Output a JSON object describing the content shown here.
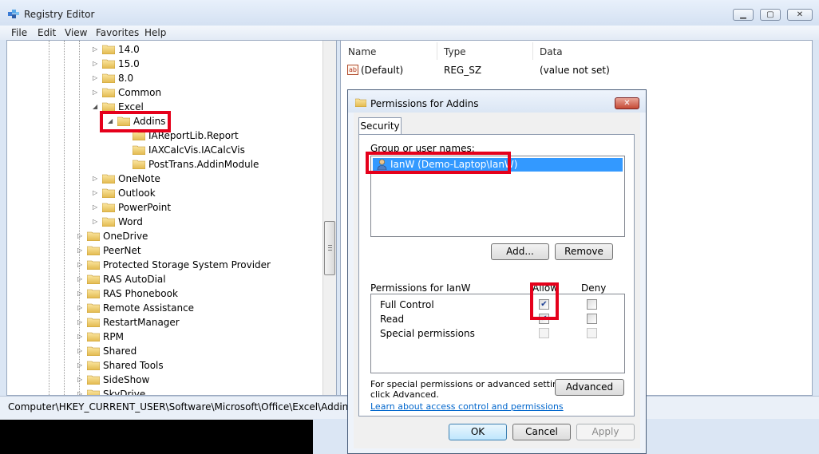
{
  "window": {
    "title": "Registry Editor",
    "controls": {
      "minimize": "▁",
      "maximize": "▢",
      "close": "✕"
    }
  },
  "menu": [
    "File",
    "Edit",
    "View",
    "Favorites",
    "Help"
  ],
  "tree": {
    "items": [
      {
        "label": "14.0",
        "level": 5,
        "toggle": "▷"
      },
      {
        "label": "15.0",
        "level": 5,
        "toggle": "▷"
      },
      {
        "label": "8.0",
        "level": 5,
        "toggle": "▷"
      },
      {
        "label": "Common",
        "level": 5,
        "toggle": "▷"
      },
      {
        "label": "Excel",
        "level": 5,
        "toggle": "◢"
      },
      {
        "label": "Addins",
        "level": 6,
        "toggle": "◢"
      },
      {
        "label": "IAReportLib.Report",
        "level": 7,
        "toggle": ""
      },
      {
        "label": "IAXCalcVis.IACalcVis",
        "level": 7,
        "toggle": ""
      },
      {
        "label": "PostTrans.AddinModule",
        "level": 7,
        "toggle": ""
      },
      {
        "label": "OneNote",
        "level": 5,
        "toggle": "▷"
      },
      {
        "label": "Outlook",
        "level": 5,
        "toggle": "▷"
      },
      {
        "label": "PowerPoint",
        "level": 5,
        "toggle": "▷"
      },
      {
        "label": "Word",
        "level": 5,
        "toggle": "▷"
      },
      {
        "label": "OneDrive",
        "level": 4,
        "toggle": "▷"
      },
      {
        "label": "PeerNet",
        "level": 4,
        "toggle": "▷"
      },
      {
        "label": "Protected Storage System Provider",
        "level": 4,
        "toggle": "▷"
      },
      {
        "label": "RAS AutoDial",
        "level": 4,
        "toggle": "▷"
      },
      {
        "label": "RAS Phonebook",
        "level": 4,
        "toggle": "▷"
      },
      {
        "label": "Remote Assistance",
        "level": 4,
        "toggle": "▷"
      },
      {
        "label": "RestartManager",
        "level": 4,
        "toggle": "▷"
      },
      {
        "label": "RPM",
        "level": 4,
        "toggle": "▷"
      },
      {
        "label": "Shared",
        "level": 4,
        "toggle": "▷"
      },
      {
        "label": "Shared Tools",
        "level": 4,
        "toggle": "▷"
      },
      {
        "label": "SideShow",
        "level": 4,
        "toggle": "▷"
      },
      {
        "label": "SkyDrive",
        "level": 4,
        "toggle": "▷"
      }
    ]
  },
  "values_list": {
    "columns": [
      "Name",
      "Type",
      "Data"
    ],
    "rows": [
      {
        "icon": "ab",
        "name": "(Default)",
        "type": "REG_SZ",
        "data": "(value not set)"
      }
    ]
  },
  "status_path": "Computer\\HKEY_CURRENT_USER\\Software\\Microsoft\\Office\\Excel\\Addins",
  "dialog": {
    "title": "Permissions for Addins",
    "close": "✕",
    "tab": "Security",
    "group_label": "Group or user names:",
    "users": [
      "IanW (Demo-Laptop\\IanW)"
    ],
    "add_button": "Add...",
    "remove_button": "Remove",
    "permissions_for": "Permissions for IanW",
    "allow_header": "Allow",
    "deny_header": "Deny",
    "permissions": [
      {
        "name": "Full Control",
        "allow": "✔",
        "deny": ""
      },
      {
        "name": "Read",
        "allow": "✔",
        "deny": ""
      },
      {
        "name": "Special permissions",
        "allow": "",
        "deny": ""
      }
    ],
    "special_note_line1": "For special permissions or advanced settings,",
    "special_note_line2": "click Advanced.",
    "advanced_button": "Advanced",
    "learn_link": "Learn about access control and permissions",
    "ok_button": "OK",
    "cancel_button": "Cancel",
    "apply_button": "Apply"
  },
  "colors": {
    "highlight": "#e5001b",
    "selection": "#3399ff",
    "link": "#0066cc"
  }
}
